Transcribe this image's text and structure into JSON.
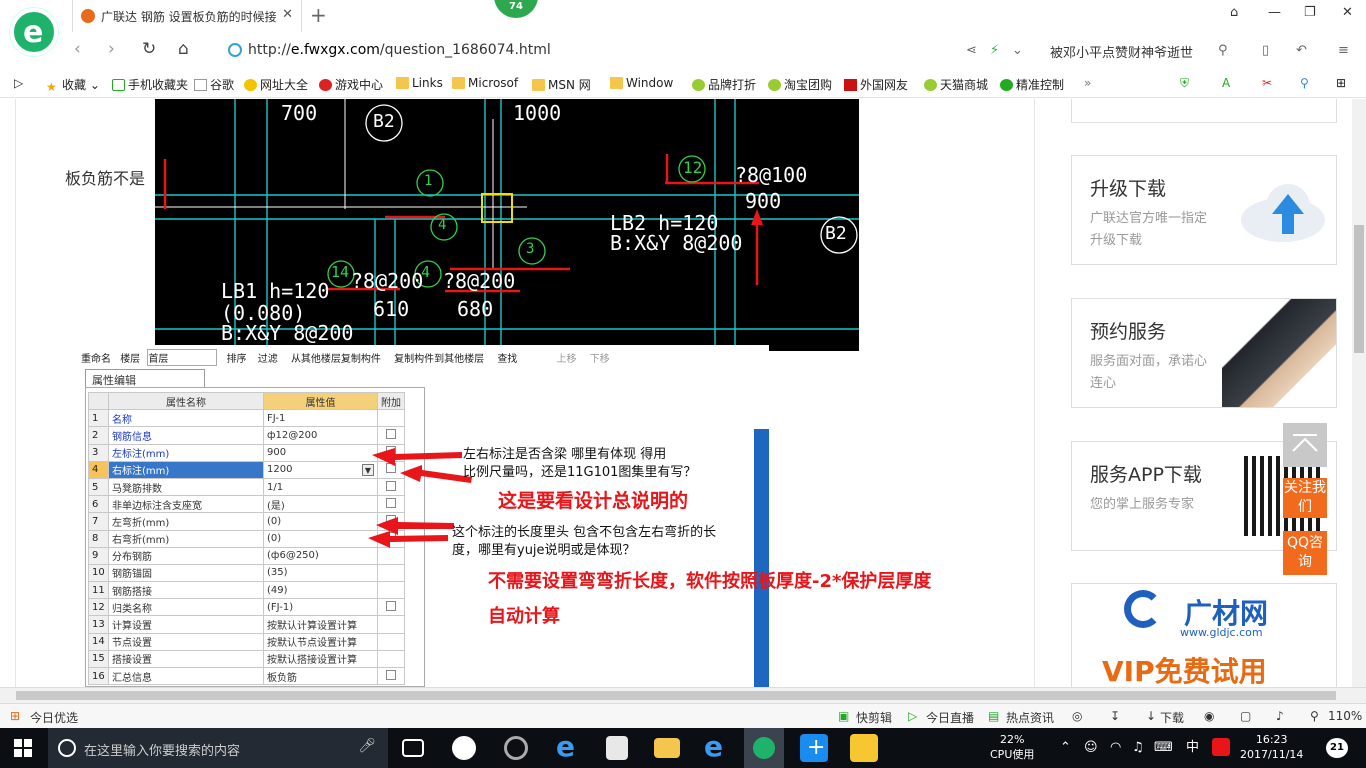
{
  "browser": {
    "badge": "74",
    "tab_title": "广联达 钢筋 设置板负筋的时候接",
    "url_scheme": "http://",
    "url_domain": "e.fwxgx.com",
    "url_path": "/question_1686074.html",
    "search_text": "被邓小平点赞财神爷逝世"
  },
  "bookmarks": [
    "收藏",
    "手机收藏夹",
    "谷歌",
    "网址大全",
    "游戏中心",
    "Links",
    "Microsof",
    "MSN 网",
    "Window",
    "品牌打折",
    "淘宝团购",
    "外国网友",
    "天猫商城",
    "精准控制"
  ],
  "article": {
    "lead": "板负筋不是"
  },
  "cad": {
    "labels": [
      "700",
      "B2",
      "1000",
      "12",
      "?8@100",
      "900",
      "LB2 h=120",
      "B:X&Y 8@200",
      "B2",
      "LB1 h=120",
      "(0.080)",
      "B:X&Y 8@200",
      "14",
      "?8@200",
      "610",
      "4",
      "?8@200",
      "680",
      "1",
      "4",
      "3"
    ]
  },
  "toolbar": {
    "items": [
      "重命名",
      "楼层",
      "首层",
      "排序",
      "过滤",
      "从其他楼层复制构件",
      "复制构件到其他楼层",
      "查找",
      "上移",
      "下移"
    ]
  },
  "property_panel": {
    "tab": "属性编辑",
    "headers": [
      "属性名称",
      "属性值",
      "附加"
    ],
    "rows": [
      {
        "no": "1",
        "name": "名称",
        "value": "FJ-1"
      },
      {
        "no": "2",
        "name": "钢筋信息",
        "value": "ф12@200"
      },
      {
        "no": "3",
        "name": "左标注(mm)",
        "value": "900"
      },
      {
        "no": "4",
        "name": "右标注(mm)",
        "value": "1200"
      },
      {
        "no": "5",
        "name": "马凳筋排数",
        "value": "1/1"
      },
      {
        "no": "6",
        "name": "非单边标注含支座宽",
        "value": "(是)"
      },
      {
        "no": "7",
        "name": "左弯折(mm)",
        "value": "(0)"
      },
      {
        "no": "8",
        "name": "右弯折(mm)",
        "value": "(0)"
      },
      {
        "no": "9",
        "name": "分布钢筋",
        "value": "(ф6@250)"
      },
      {
        "no": "10",
        "name": "钢筋锚固",
        "value": "(35)"
      },
      {
        "no": "11",
        "name": "钢筋搭接",
        "value": "(49)"
      },
      {
        "no": "12",
        "name": "归类名称",
        "value": "(FJ-1)"
      },
      {
        "no": "13",
        "name": "计算设置",
        "value": "按默认计算设置计算"
      },
      {
        "no": "14",
        "name": "节点设置",
        "value": "按默认节点设置计算"
      },
      {
        "no": "15",
        "name": "搭接设置",
        "value": "按默认搭接设置计算"
      },
      {
        "no": "16",
        "name": "汇总信息",
        "value": "板负筋"
      }
    ]
  },
  "notes": {
    "q1_line1": "左右标注是否含梁 哪里有体现 得用",
    "q1_line2": "比例尺量吗，还是11G101图集里有写？",
    "a1": "这是要看设计总说明的",
    "q2_line1": "这个标注的长度里头 包含不包含左右弯折的长",
    "q2_line2": "度，哪里有yuje说明或是体现？",
    "a2_line1": "不需要设置弯弯折长度，软件按照板厚度-2*保护层厚度",
    "a2_line2": "自动计算"
  },
  "sidebar": {
    "upgrade_title": "升级下载",
    "upgrade_desc": "广联达官方唯一指定升级下载",
    "booking_title": "预约服务",
    "booking_desc": "服务面对面，承诺心连心",
    "app_title": "服务APP下载",
    "app_desc": "您的掌上服务专家",
    "ad_brand": "广材网",
    "ad_url": "www.gldjc.com",
    "ad_slogan": "VIP免费试用",
    "follow_btn": "关注我们",
    "qq_btn": "QQ咨询"
  },
  "statusbar": {
    "left": "今日优选",
    "items": [
      "快剪辑",
      "今日直播",
      "热点资讯",
      "下载"
    ],
    "zoom": "110%"
  },
  "taskbar": {
    "search_placeholder": "在这里输入你要搜索的内容",
    "cpu_pct": "22%",
    "cpu_label": "CPU使用",
    "ime": "中",
    "time": "16:23",
    "date": "2017/11/14",
    "notif_count": "21"
  },
  "colors": {
    "accent_red": "#e8151a",
    "link_blue": "#1a37c8",
    "brand_green": "#1fb26b",
    "orange": "#f26b1d"
  }
}
